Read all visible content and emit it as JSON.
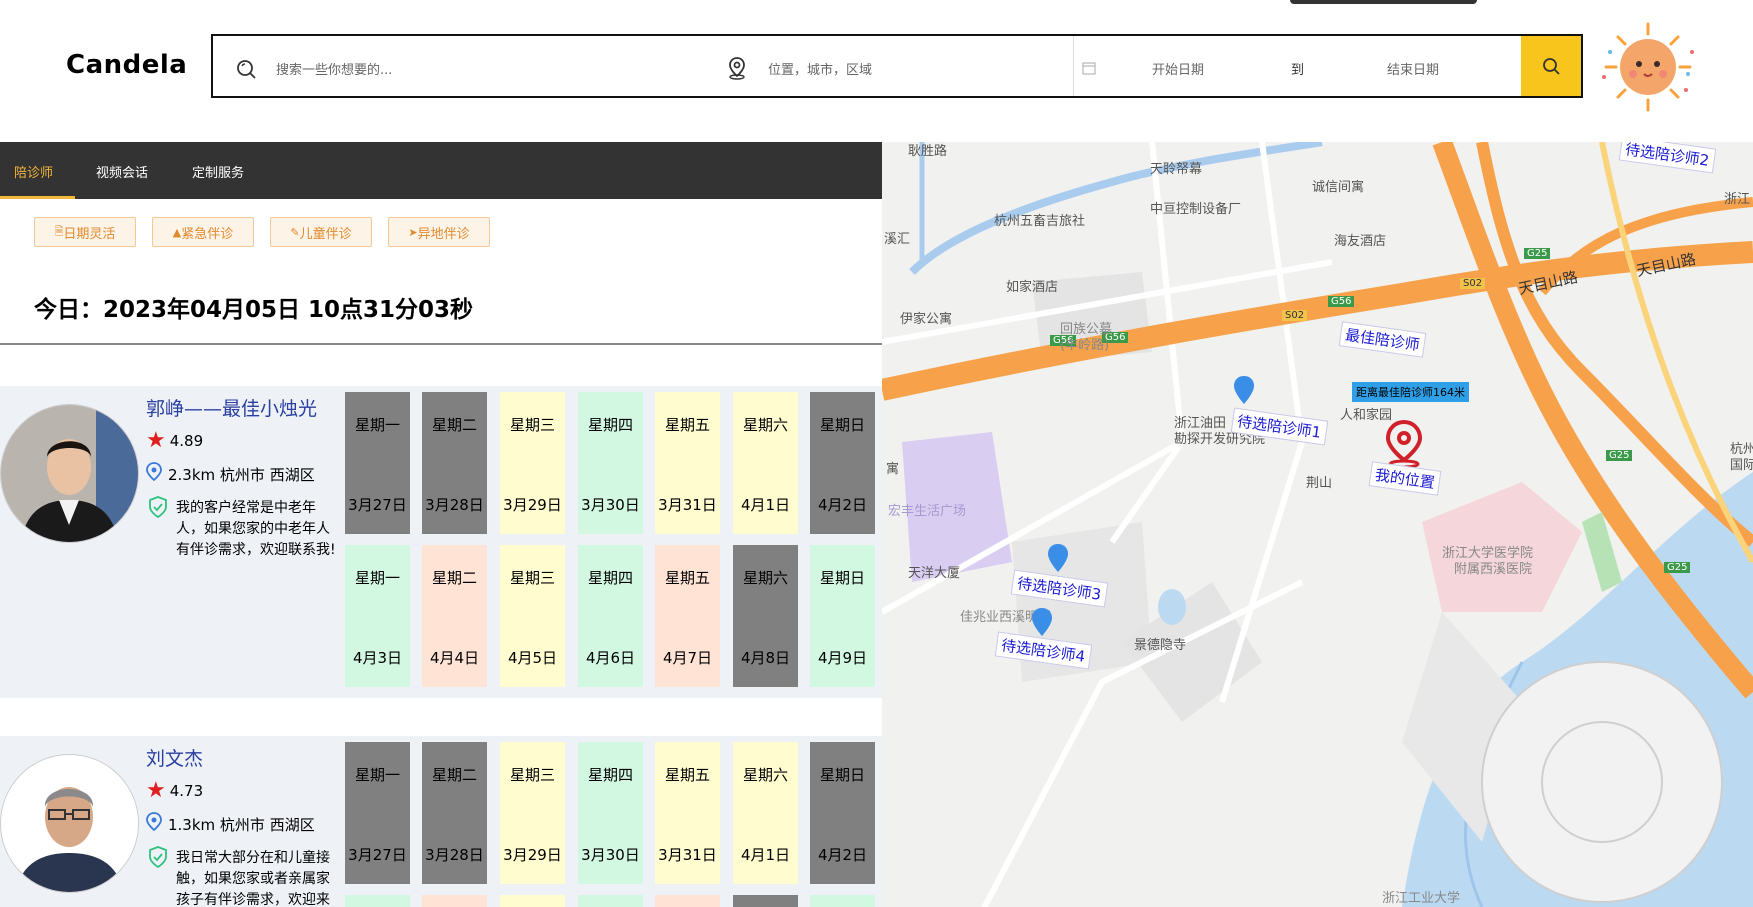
{
  "header": {
    "logo": "Candela",
    "search_placeholder": "搜索一些你想要的...",
    "location_placeholder": "位置，城市，区域",
    "start_date_placeholder": "开始日期",
    "to_label": "到",
    "end_date_placeholder": "结束日期"
  },
  "tabs": [
    {
      "label": "陪诊师",
      "active": true
    },
    {
      "label": "视频会话",
      "active": false
    },
    {
      "label": "定制服务",
      "active": false
    }
  ],
  "filters": [
    "日期灵活",
    "紧急伴诊",
    "儿童伴诊",
    "异地伴诊"
  ],
  "today": "今日：2023年04月05日 10点31分03秒",
  "colors": {
    "accent": "#f4b63a",
    "gray_day": "#808080",
    "yellow_day": "#fffdd0",
    "green_day": "#d3f8e2",
    "orange_day": "#ffe4d6"
  },
  "escorts": [
    {
      "name": "郭峥——最佳小烛光",
      "rating": "4.89",
      "location": "2.3km 杭州市 西湖区",
      "description": "我的客户经常是中老年人，如果您家的中老年人有伴诊需求，欢迎联系我!",
      "week1": [
        {
          "weekday": "星期一",
          "date": "3月27日",
          "status": "gray"
        },
        {
          "weekday": "星期二",
          "date": "3月28日",
          "status": "gray"
        },
        {
          "weekday": "星期三",
          "date": "3月29日",
          "status": "yellow"
        },
        {
          "weekday": "星期四",
          "date": "3月30日",
          "status": "green"
        },
        {
          "weekday": "星期五",
          "date": "3月31日",
          "status": "yellow"
        },
        {
          "weekday": "星期六",
          "date": "4月1日",
          "status": "yellow"
        },
        {
          "weekday": "星期日",
          "date": "4月2日",
          "status": "gray"
        }
      ],
      "week2": [
        {
          "weekday": "星期一",
          "date": "4月3日",
          "status": "green"
        },
        {
          "weekday": "星期二",
          "date": "4月4日",
          "status": "orange"
        },
        {
          "weekday": "星期三",
          "date": "4月5日",
          "status": "yellow"
        },
        {
          "weekday": "星期四",
          "date": "4月6日",
          "status": "green"
        },
        {
          "weekday": "星期五",
          "date": "4月7日",
          "status": "orange"
        },
        {
          "weekday": "星期六",
          "date": "4月8日",
          "status": "gray"
        },
        {
          "weekday": "星期日",
          "date": "4月9日",
          "status": "green"
        }
      ]
    },
    {
      "name": "刘文杰",
      "rating": "4.73",
      "location": "1.3km 杭州市 西湖区",
      "description": "我日常大部分在和儿童接触，如果您家或者亲属家孩子有伴诊需求，欢迎来找",
      "week1": [
        {
          "weekday": "星期一",
          "date": "3月27日",
          "status": "gray"
        },
        {
          "weekday": "星期二",
          "date": "3月28日",
          "status": "gray"
        },
        {
          "weekday": "星期三",
          "date": "3月29日",
          "status": "yellow"
        },
        {
          "weekday": "星期四",
          "date": "3月30日",
          "status": "green"
        },
        {
          "weekday": "星期五",
          "date": "3月31日",
          "status": "yellow"
        },
        {
          "weekday": "星期六",
          "date": "4月1日",
          "status": "yellow"
        },
        {
          "weekday": "星期日",
          "date": "4月2日",
          "status": "gray"
        }
      ],
      "week2_partial_status": [
        "green",
        "orange",
        "yellow",
        "green",
        "orange",
        "gray",
        "green"
      ]
    }
  ],
  "map": {
    "markers": {
      "best": "最佳陪诊师",
      "c1": "待选陪诊师1",
      "c2": "待选陪诊师2",
      "c3": "待选陪诊师3",
      "c4": "待选陪诊师4",
      "me": "我的位置",
      "distance": "距离最佳陪诊师164米"
    },
    "labels": {
      "l1": "耿胜路",
      "l2": "天聆帑幕",
      "l3": "诚信间寓",
      "l4": "杭州五畜吉旅社",
      "l5": "中亘控制设备厂",
      "l6": "浙江",
      "l7": "溪汇",
      "l8": "海友酒店",
      "l9": "如家酒店",
      "l10": "伊家公寓",
      "l11": "回族公墓",
      "l12": "(丰岭路)",
      "l13": "天目山路",
      "l14": "天目山路",
      "l15": "浙江油田",
      "l16": "勘探开发研究院",
      "l17": "人和家园",
      "l18": "荆山",
      "l19": "宏丰生活广场",
      "l20": "天洋大厦",
      "l21": "佳兆业西溪明园",
      "l22": "景德隐寺",
      "l23": "浙江大学医学院",
      "l24": "附属西溪医院",
      "l25": "浙江工业大学",
      "l26": "杭州",
      "l27": "国际",
      "l28": "寓"
    },
    "roads": {
      "g56a": "G56",
      "g56b": "G56",
      "g56c": "G56",
      "s02a": "S02",
      "s02b": "S02",
      "g25a": "G25",
      "g25b": "G25",
      "g25c": "G25"
    }
  }
}
